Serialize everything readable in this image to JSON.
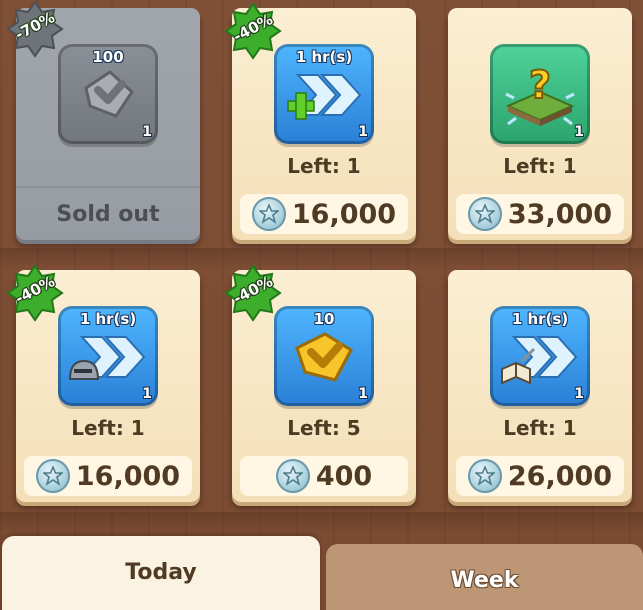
{
  "shop": {
    "items": [
      {
        "discount": "-70%",
        "tile_label": "100",
        "quantity": "1",
        "icon": "gray-shield-icon",
        "status": "Sold out",
        "sold_out": true
      },
      {
        "discount": "-40%",
        "tile_label": "1 hr(s)",
        "quantity": "1",
        "icon": "speedup-plus-icon",
        "left": "Left: 1",
        "price": "16,000"
      },
      {
        "discount": "",
        "tile_label": "",
        "quantity": "1",
        "icon": "mystery-tile-icon",
        "left": "Left: 1",
        "price": "33,000"
      },
      {
        "discount": "-40%",
        "tile_label": "1 hr(s)",
        "quantity": "1",
        "icon": "speedup-helmet-icon",
        "left": "Left: 1",
        "price": "16,000"
      },
      {
        "discount": "-40%",
        "tile_label": "10",
        "quantity": "1",
        "icon": "gold-shield-icon",
        "left": "Left: 5",
        "price": "400"
      },
      {
        "discount": "",
        "tile_label": "1 hr(s)",
        "quantity": "1",
        "icon": "speedup-book-icon",
        "left": "Left: 1",
        "price": "26,000"
      }
    ]
  },
  "tabs": {
    "today": "Today",
    "week": "Week",
    "active": "Today"
  },
  "colors": {
    "background": "#7f4f36",
    "card": "#fbeed3",
    "sold_card": "#a1a6ad",
    "badge_green": "#3cae2c",
    "price_text": "#4f3a24"
  }
}
